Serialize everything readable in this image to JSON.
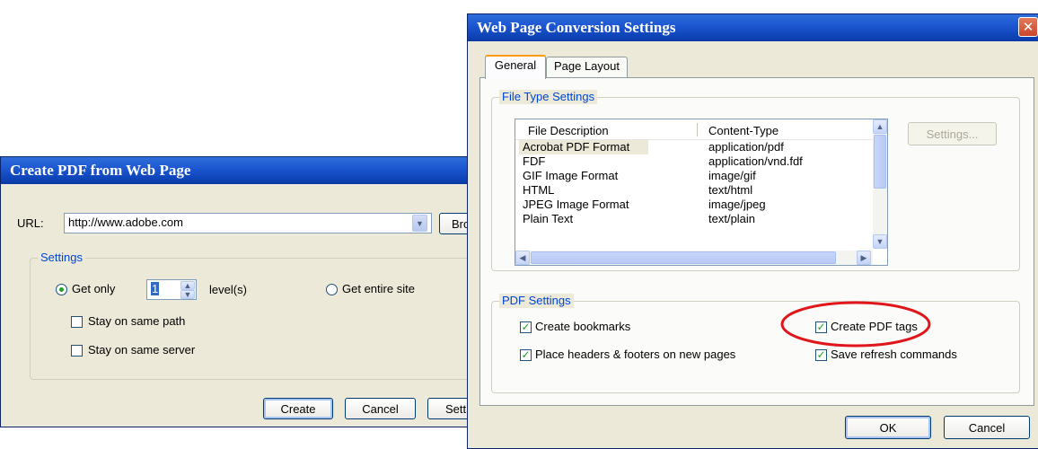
{
  "create_dialog": {
    "title": "Create PDF from Web Page",
    "url_label": "URL:",
    "url_value": "http://www.adobe.com",
    "browse_label": "Browse...",
    "settings_group": "Settings",
    "get_only_label": "Get only",
    "levels_value": "1",
    "levels_label": "level(s)",
    "get_entire_site_label": "Get entire site",
    "stay_same_path_label": "Stay on same path",
    "stay_same_server_label": "Stay on same server",
    "create_button": "Create",
    "cancel_button": "Cancel",
    "settings_button": "Settings..."
  },
  "conversion_dialog": {
    "title": "Web Page Conversion Settings",
    "close_glyph": "✕",
    "tabs": [
      {
        "label": "General",
        "active": true
      },
      {
        "label": "Page Layout",
        "active": false
      }
    ],
    "file_type_group": "File Type Settings",
    "columns": [
      "File Description",
      "Content-Type"
    ],
    "rows": [
      {
        "description": "Acrobat PDF Format",
        "content_type": "application/pdf",
        "selected": true
      },
      {
        "description": "FDF",
        "content_type": "application/vnd.fdf",
        "selected": false
      },
      {
        "description": "GIF Image Format",
        "content_type": "image/gif",
        "selected": false
      },
      {
        "description": "HTML",
        "content_type": "text/html",
        "selected": false
      },
      {
        "description": "JPEG Image Format",
        "content_type": "image/jpeg",
        "selected": false
      },
      {
        "description": "Plain Text",
        "content_type": "text/plain",
        "selected": false
      }
    ],
    "file_settings_button": "Settings...",
    "pdf_settings_group": "PDF Settings",
    "create_bookmarks_label": "Create bookmarks",
    "create_pdf_tags_label": "Create PDF tags",
    "headers_footers_label": "Place headers & footers on new pages",
    "save_refresh_label": "Save refresh commands",
    "ok_button": "OK",
    "cancel_button": "Cancel"
  },
  "colors": {
    "highlight_ellipse": "#e0161b",
    "title_bar": "#0b3aa4",
    "dialog_face": "#ece9d8",
    "check_mark": "#21a121"
  }
}
